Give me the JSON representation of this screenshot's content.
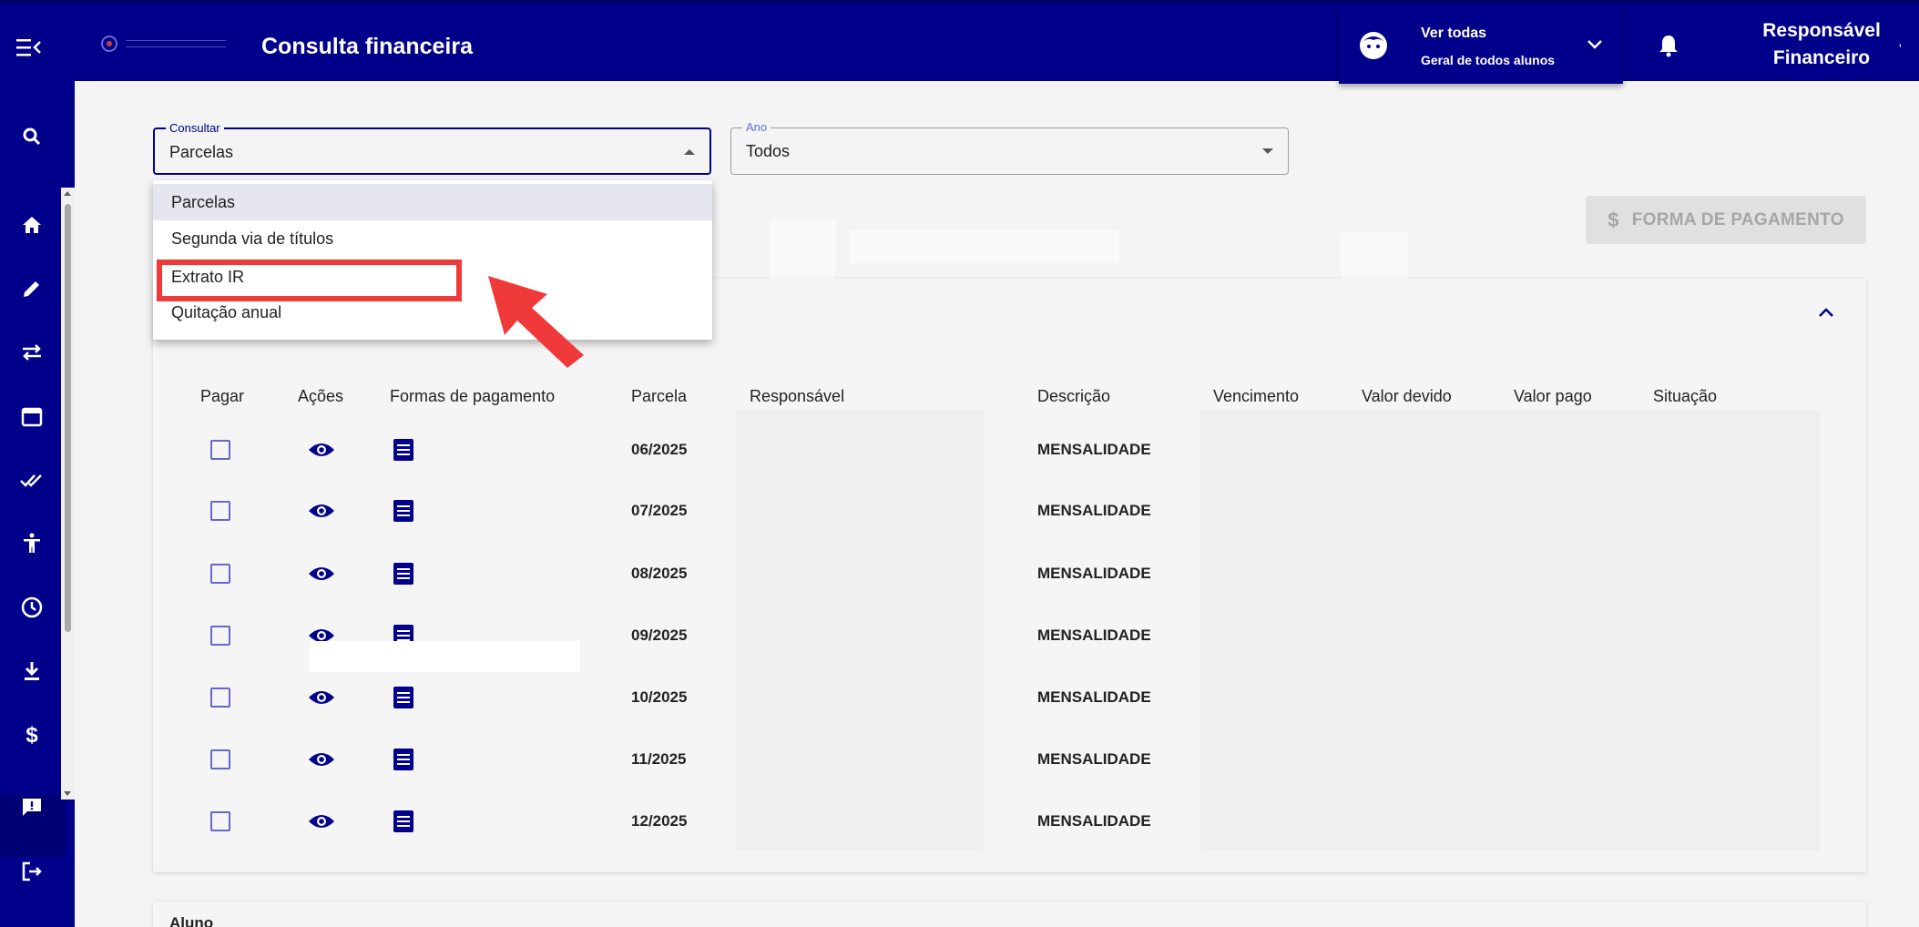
{
  "header": {
    "title": "Consulta financeira",
    "student_selector": {
      "name": "Ver todas",
      "subtitle": "Geral de todos alunos"
    },
    "user": {
      "line1": "Responsável",
      "line2": "Financeiro",
      "extra": "'"
    }
  },
  "sidebar": {
    "items": [
      {
        "icon": "search-icon"
      },
      {
        "icon": "home-icon"
      },
      {
        "icon": "pencil-icon"
      },
      {
        "icon": "transfer-icon"
      },
      {
        "icon": "calendar-icon"
      },
      {
        "icon": "double-check-icon"
      },
      {
        "icon": "accessibility-icon"
      },
      {
        "icon": "clock-icon"
      },
      {
        "icon": "download-icon"
      },
      {
        "icon": "dollar-icon",
        "active": true
      },
      {
        "icon": "message-icon"
      },
      {
        "icon": "logout-icon"
      }
    ]
  },
  "filters": {
    "consultar": {
      "label": "Consultar",
      "value": "Parcelas"
    },
    "ano": {
      "label": "Ano",
      "value": "Todos"
    }
  },
  "dropdown": {
    "options": [
      "Parcelas",
      "Segunda via de títulos",
      "Extrato IR",
      "Quitação anual"
    ],
    "selected": "Parcelas",
    "highlighted": "Extrato IR"
  },
  "actions": {
    "payment_button": "FORMA DE PAGAMENTO",
    "payment_button_icon": "$"
  },
  "table": {
    "columns": [
      "Pagar",
      "Ações",
      "Formas de pagamento",
      "Parcela",
      "Responsável",
      "Descrição",
      "Vencimento",
      "Valor devido",
      "Valor pago",
      "Situação"
    ],
    "rows": [
      {
        "parcela": "06/2025",
        "descricao": "MENSALIDADE"
      },
      {
        "parcela": "07/2025",
        "descricao": "MENSALIDADE"
      },
      {
        "parcela": "08/2025",
        "descricao": "MENSALIDADE"
      },
      {
        "parcela": "09/2025",
        "descricao": "MENSALIDADE"
      },
      {
        "parcela": "10/2025",
        "descricao": "MENSALIDADE"
      },
      {
        "parcela": "11/2025",
        "descricao": "MENSALIDADE"
      },
      {
        "parcela": "12/2025",
        "descricao": "MENSALIDADE"
      }
    ]
  },
  "next_section": {
    "label": "Aluno"
  },
  "colors": {
    "primary": "#00008b",
    "highlight": "#f03a3a"
  }
}
